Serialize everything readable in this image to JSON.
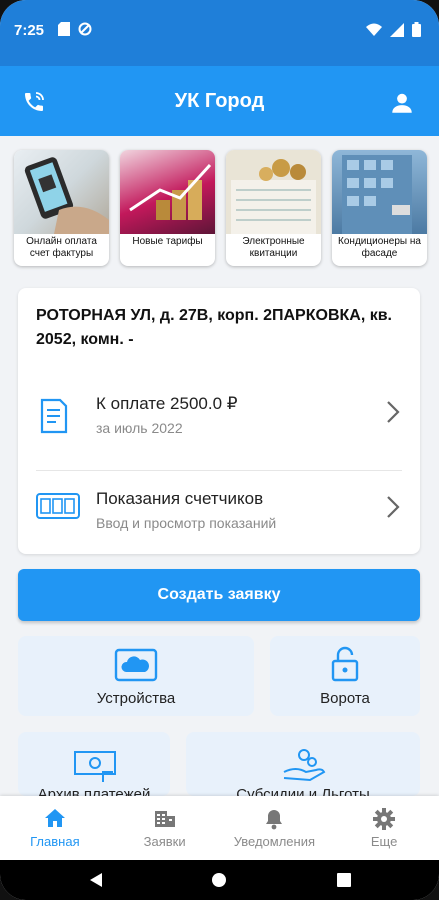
{
  "status_bar": {
    "time": "7:25"
  },
  "header": {
    "title": "УК Город"
  },
  "stories": [
    {
      "caption": "Онлайн оплата счет фактуры"
    },
    {
      "caption": "Новые тарифы"
    },
    {
      "caption": "Электронные квитанции"
    },
    {
      "caption": "Кондиционеры на фасаде"
    }
  ],
  "account": {
    "address": "РОТОРНАЯ УЛ, д. 27В, корп. 2ПАРКОВКА, кв. 2052, комн. -",
    "payment": {
      "title": "К оплате 2500.0 ₽",
      "subtitle": "за июль 2022"
    },
    "meters": {
      "title": "Показания счетчиков",
      "subtitle": "Ввод и просмотр показаний"
    }
  },
  "create_request_label": "Создать заявку",
  "tiles": {
    "devices": "Устройства",
    "gates": "Ворота",
    "payments_archive": "Архив платежей",
    "subsidies": "Субсидии и Льготы"
  },
  "tabs": {
    "home": "Главная",
    "requests": "Заявки",
    "notifications": "Уведомления",
    "more": "Еще"
  },
  "colors": {
    "primary": "#2196f3",
    "status_bar": "#1f7fd9",
    "tile_bg": "#e8f1fb"
  },
  "icons": [
    "phone-icon",
    "user-icon",
    "receipt-icon",
    "meter-icon",
    "chevron-right-icon",
    "cloud-device-icon",
    "lock-icon",
    "money-icon",
    "hand-coins-icon",
    "home-icon",
    "building-icon",
    "bell-icon",
    "gear-icon"
  ]
}
